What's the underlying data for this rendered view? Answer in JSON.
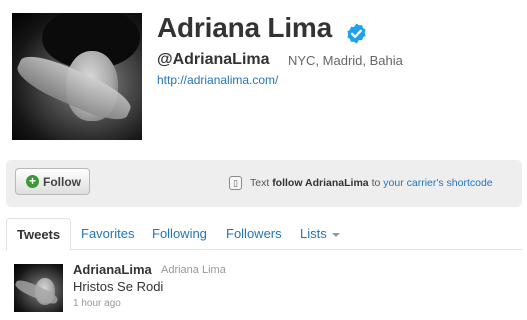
{
  "profile": {
    "full_name": "Adriana Lima",
    "screen_name": "@AdrianaLima",
    "location": "NYC, Madrid, Bahia",
    "website": "http://adrianalima.com/",
    "verified_color": "#1da1f2"
  },
  "follow_bar": {
    "follow_label": "Follow",
    "sms_prefix": "Text",
    "sms_command": "follow AdrianaLima",
    "sms_middle": "to",
    "sms_link": "your carrier's shortcode"
  },
  "tabs": [
    {
      "label": "Tweets",
      "active": true
    },
    {
      "label": "Favorites",
      "active": false
    },
    {
      "label": "Following",
      "active": false
    },
    {
      "label": "Followers",
      "active": false
    },
    {
      "label": "Lists",
      "active": false
    }
  ],
  "tweet": {
    "screen_name": "AdrianaLima",
    "full_name": "Adriana Lima",
    "text": "Hristos Se Rodi",
    "time": "1 hour ago"
  },
  "colors": {
    "link": "#2276bb",
    "follow_bar_bg": "#eeeeee",
    "plus_icon": "#3a9a33"
  }
}
